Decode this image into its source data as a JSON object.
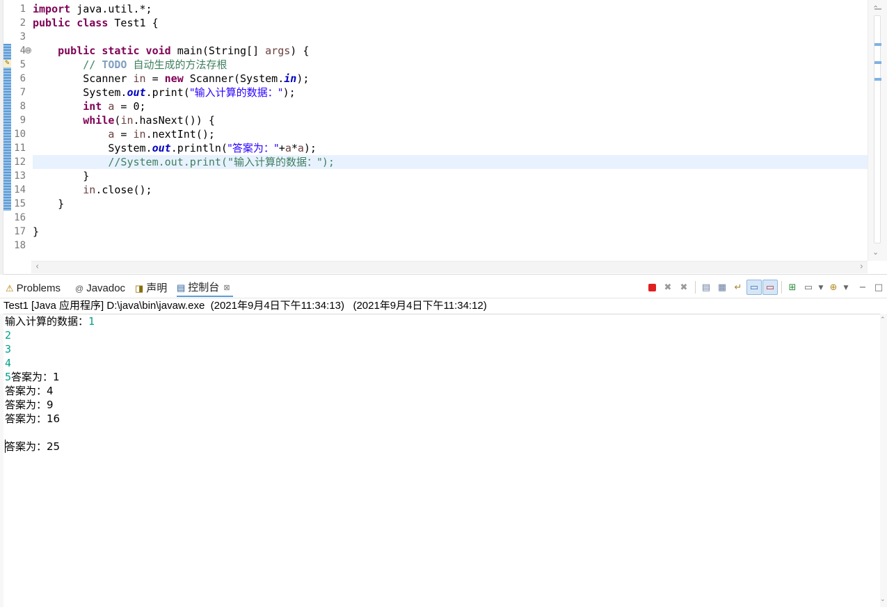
{
  "editor": {
    "line_numbers": [
      "1",
      "2",
      "3",
      "4",
      "5",
      "6",
      "7",
      "8",
      "9",
      "10",
      "11",
      "12",
      "13",
      "14",
      "15",
      "16",
      "17",
      "18"
    ],
    "fold_symbol": "⊖",
    "lines": [
      [
        {
          "t": "kw",
          "v": "import"
        },
        {
          "t": "p",
          "v": " java.util.*;"
        }
      ],
      [
        {
          "t": "kw",
          "v": "public class"
        },
        {
          "t": "p",
          "v": " Test1 {"
        }
      ],
      [],
      [
        {
          "t": "p",
          "v": "    "
        },
        {
          "t": "kw",
          "v": "public static void"
        },
        {
          "t": "p",
          "v": " main(String[] "
        },
        {
          "t": "var",
          "v": "args"
        },
        {
          "t": "p",
          "v": ") {"
        }
      ],
      [
        {
          "t": "cm",
          "v": "        // "
        },
        {
          "t": "todo",
          "v": "TODO"
        },
        {
          "t": "cm",
          "v": " "
        },
        {
          "t": "cmcjk",
          "v": "自动生成的方法存根"
        }
      ],
      [
        {
          "t": "p",
          "v": "        Scanner "
        },
        {
          "t": "var",
          "v": "in"
        },
        {
          "t": "p",
          "v": " = "
        },
        {
          "t": "kw",
          "v": "new"
        },
        {
          "t": "p",
          "v": " Scanner(System."
        },
        {
          "t": "fld",
          "v": "in"
        },
        {
          "t": "p",
          "v": ");"
        }
      ],
      [
        {
          "t": "p",
          "v": "        System."
        },
        {
          "t": "fld",
          "v": "out"
        },
        {
          "t": "p",
          "v": ".print("
        },
        {
          "t": "strcjk",
          "v": "\"输入计算的数据：\""
        },
        {
          "t": "p",
          "v": ");"
        }
      ],
      [
        {
          "t": "p",
          "v": "        "
        },
        {
          "t": "kw",
          "v": "int"
        },
        {
          "t": "p",
          "v": " "
        },
        {
          "t": "var",
          "v": "a"
        },
        {
          "t": "p",
          "v": " = 0;"
        }
      ],
      [
        {
          "t": "p",
          "v": "        "
        },
        {
          "t": "kw",
          "v": "while"
        },
        {
          "t": "p",
          "v": "("
        },
        {
          "t": "var",
          "v": "in"
        },
        {
          "t": "p",
          "v": ".hasNext()) {"
        }
      ],
      [
        {
          "t": "p",
          "v": "            "
        },
        {
          "t": "var",
          "v": "a"
        },
        {
          "t": "p",
          "v": " = "
        },
        {
          "t": "var",
          "v": "in"
        },
        {
          "t": "p",
          "v": ".nextInt();"
        }
      ],
      [
        {
          "t": "p",
          "v": "            System."
        },
        {
          "t": "fld",
          "v": "out"
        },
        {
          "t": "p",
          "v": ".println("
        },
        {
          "t": "strcjk",
          "v": "\"答案为：\""
        },
        {
          "t": "p",
          "v": "+"
        },
        {
          "t": "var",
          "v": "a"
        },
        {
          "t": "p",
          "v": "*"
        },
        {
          "t": "var",
          "v": "a"
        },
        {
          "t": "p",
          "v": ");"
        }
      ],
      [
        {
          "t": "cm",
          "v": "            //System.out.print(\""
        },
        {
          "t": "cmcjk",
          "v": "输入计算的数据：\""
        },
        {
          "t": "cm",
          "v": ");"
        }
      ],
      [
        {
          "t": "p",
          "v": "        }"
        }
      ],
      [
        {
          "t": "p",
          "v": "        "
        },
        {
          "t": "var",
          "v": "in"
        },
        {
          "t": "p",
          "v": ".close();"
        }
      ],
      [
        {
          "t": "p",
          "v": "    }"
        }
      ],
      [],
      [
        {
          "t": "p",
          "v": "}"
        }
      ],
      []
    ]
  },
  "views": {
    "tabs": [
      {
        "label": "Problems",
        "icon": "problems-icon",
        "glyph": "⚠"
      },
      {
        "label": "Javadoc",
        "icon": "javadoc-icon",
        "glyph": "@"
      },
      {
        "label": "声明",
        "icon": "declaration-icon",
        "glyph": "◨"
      },
      {
        "label": "控制台",
        "icon": "console-icon",
        "glyph": "▤"
      }
    ],
    "console_close": "⊠"
  },
  "console": {
    "description": "Test1 [Java 应用程序] D:\\java\\bin\\javaw.exe  (2021年9月4日下午11:34:13)   (2021年9月4日下午11:34:12)",
    "lines": [
      [
        {
          "t": "out",
          "v": "输入计算的数据："
        },
        {
          "t": "in",
          "v": "1"
        }
      ],
      [
        {
          "t": "in",
          "v": "2"
        }
      ],
      [
        {
          "t": "in",
          "v": "3"
        }
      ],
      [
        {
          "t": "in",
          "v": "4"
        }
      ],
      [
        {
          "t": "in",
          "v": "5"
        },
        {
          "t": "out",
          "v": "答案为：1"
        }
      ],
      [
        {
          "t": "out",
          "v": "答案为：4"
        }
      ],
      [
        {
          "t": "out",
          "v": "答案为：9"
        }
      ],
      [
        {
          "t": "out",
          "v": "答案为：16"
        }
      ],
      [],
      [
        {
          "t": "out",
          "v": "答案为：25"
        }
      ]
    ]
  },
  "colors": {
    "keyword": "#7f0055",
    "comment": "#3f7f5f",
    "string": "#2a00ff",
    "field": "#0000c0",
    "console_input": "#00a08a",
    "current_line": "#e8f2fe"
  }
}
